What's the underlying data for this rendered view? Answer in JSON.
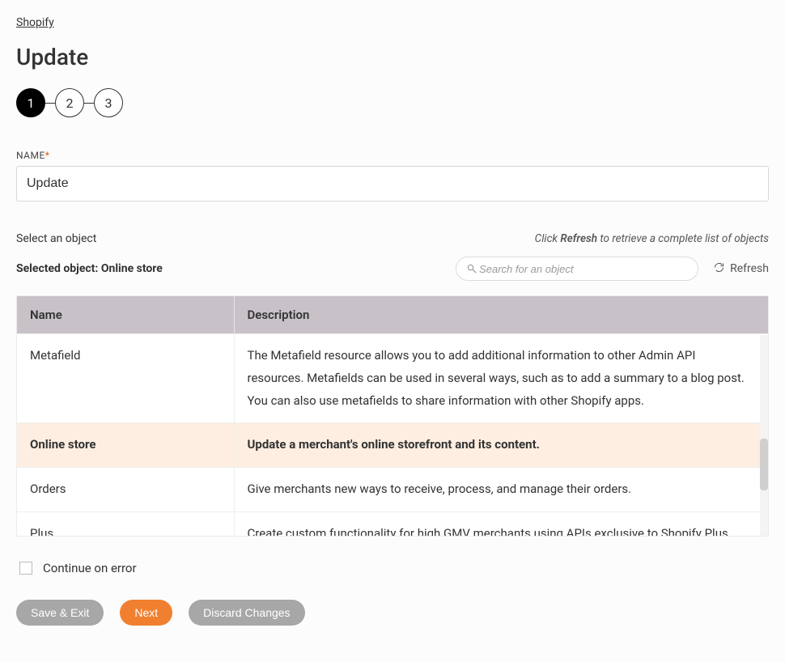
{
  "breadcrumb": "Shopify",
  "page_title": "Update",
  "stepper": {
    "steps": [
      "1",
      "2",
      "3"
    ],
    "active_index": 0
  },
  "name_field": {
    "label": "NAME",
    "required_marker": "*",
    "value": "Update"
  },
  "select_heading": "Select an object",
  "helper_pre": "Click ",
  "helper_strong": "Refresh",
  "helper_post": " to retrieve a complete list of objects",
  "selected_prefix": "Selected object: ",
  "selected_value": "Online store",
  "search": {
    "placeholder": "Search for an object"
  },
  "refresh_label": "Refresh",
  "table": {
    "columns": {
      "name": "Name",
      "description": "Description"
    },
    "rows": [
      {
        "name": "Metafield",
        "description": "The Metafield resource allows you to add additional information to other Admin API resources. Metafields can be used in several ways, such as to add a summary to a blog post. You can also use metafields to share information with other Shopify apps.",
        "selected": false
      },
      {
        "name": "Online store",
        "description": "Update a merchant's online storefront and its content.",
        "selected": true
      },
      {
        "name": "Orders",
        "description": "Give merchants new ways to receive, process, and manage their orders.",
        "selected": false
      },
      {
        "name": "Plus",
        "description": "Create custom functionality for high GMV merchants using APIs exclusive to Shopify Plus.",
        "selected": false
      }
    ]
  },
  "continue_on_error_label": "Continue on error",
  "buttons": {
    "save_exit": "Save & Exit",
    "next": "Next",
    "discard": "Discard Changes"
  }
}
